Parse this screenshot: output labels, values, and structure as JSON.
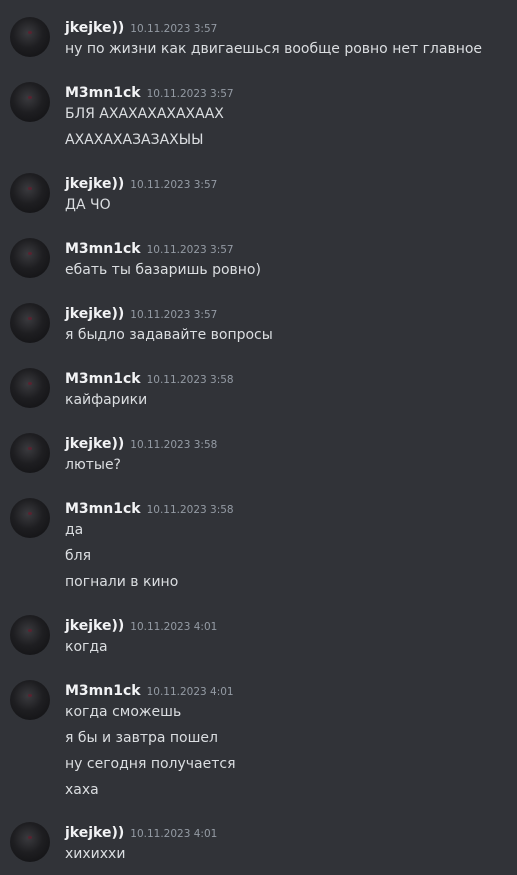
{
  "messages": [
    {
      "author": "jkejke))",
      "time": "10.11.2023 3:57",
      "lines": [
        "ну по жизни как двигаешься вообще ровно нет главное"
      ]
    },
    {
      "author": "M3mn1ck",
      "time": "10.11.2023 3:57",
      "lines": [
        "БЛЯ АХАХАХАХАХААХ",
        "АХАХАХАЗАЗАХЫЫ"
      ]
    },
    {
      "author": "jkejke))",
      "time": "10.11.2023 3:57",
      "lines": [
        "ДА ЧО"
      ]
    },
    {
      "author": "M3mn1ck",
      "time": "10.11.2023 3:57",
      "lines": [
        "ебать ты базаришь ровно)"
      ]
    },
    {
      "author": "jkejke))",
      "time": "10.11.2023 3:57",
      "lines": [
        "я быдло задавайте вопросы"
      ]
    },
    {
      "author": "M3mn1ck",
      "time": "10.11.2023 3:58",
      "lines": [
        "кайфарики"
      ]
    },
    {
      "author": "jkejke))",
      "time": "10.11.2023 3:58",
      "lines": [
        "лютые?"
      ]
    },
    {
      "author": "M3mn1ck",
      "time": "10.11.2023 3:58",
      "lines": [
        "да",
        "бля",
        "погнали в кино"
      ]
    },
    {
      "author": "jkejke))",
      "time": "10.11.2023 4:01",
      "lines": [
        "когда"
      ]
    },
    {
      "author": "M3mn1ck",
      "time": "10.11.2023 4:01",
      "lines": [
        "когда сможешь",
        "я бы и завтра пошел",
        "ну сегодня получается",
        "хаха"
      ]
    },
    {
      "author": "jkejke))",
      "time": "10.11.2023 4:01",
      "lines": [
        "хихиххи"
      ]
    }
  ]
}
